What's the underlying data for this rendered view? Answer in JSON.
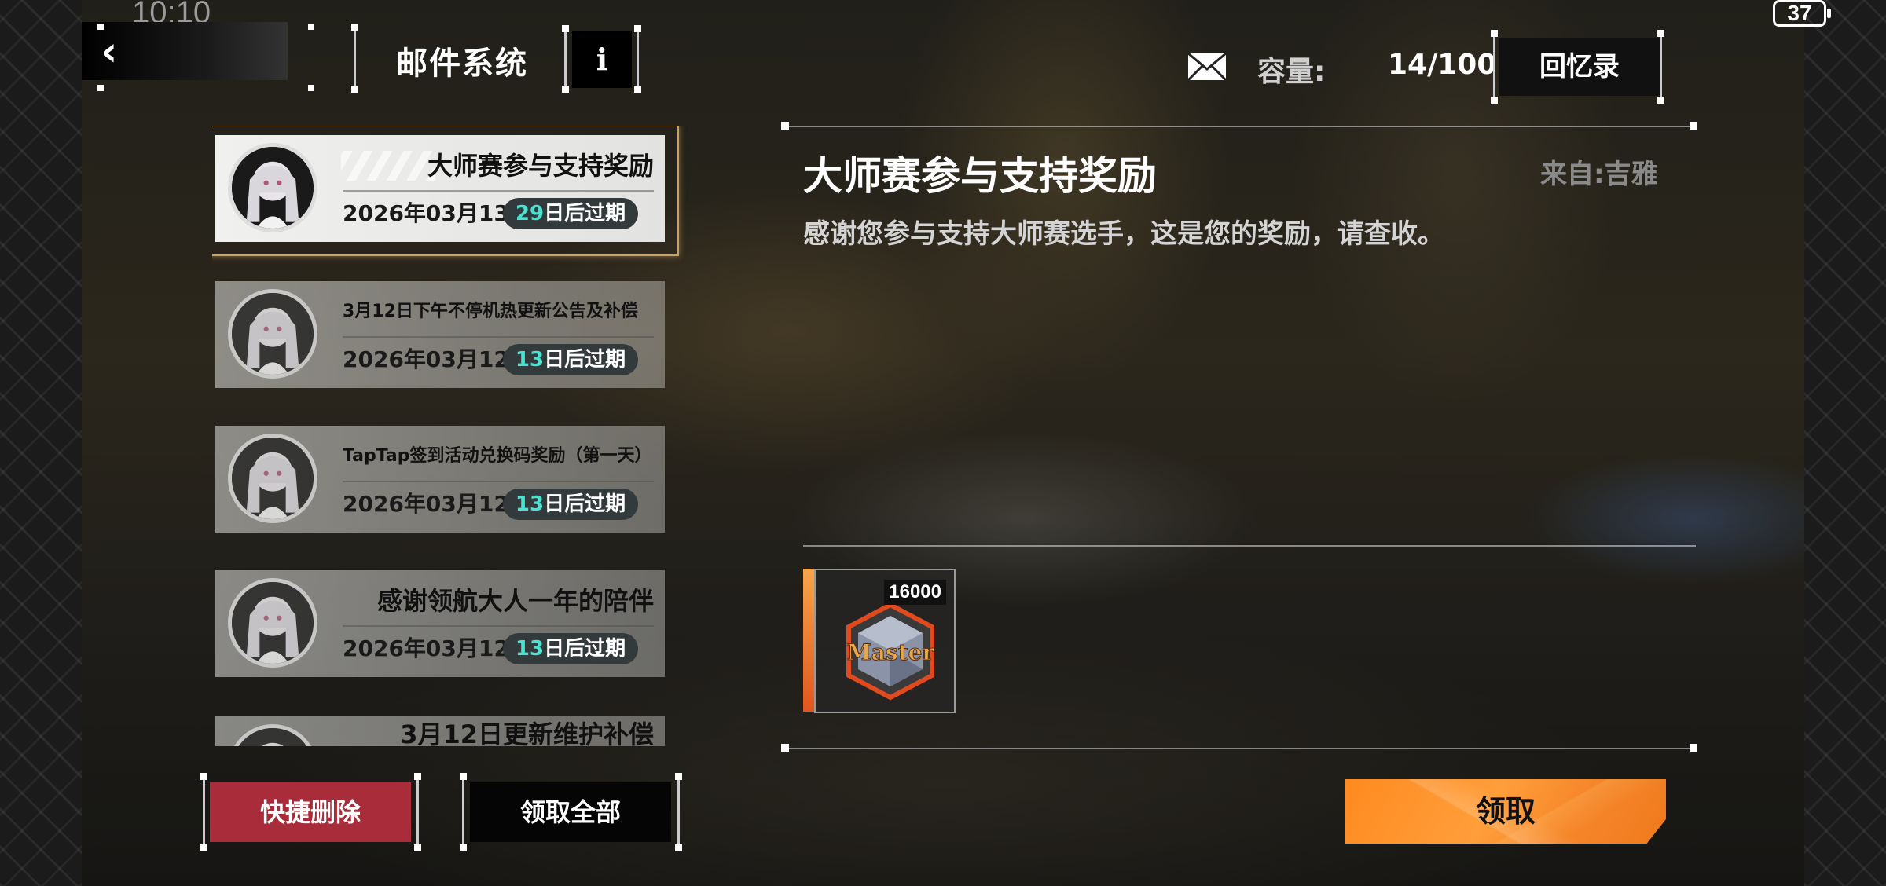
{
  "status_bar": {
    "time": "10:10",
    "battery": "37"
  },
  "header": {
    "title": "邮件系统",
    "info_label": "i",
    "capacity_label": "容量:",
    "capacity_value": "14/100",
    "memory_button": "回忆录"
  },
  "mails": [
    {
      "title": "大师赛参与支持奖励",
      "date": "2026年03月13日",
      "days": "29",
      "expiry_suffix": "日后过期",
      "selected": true
    },
    {
      "title": "3月12日下午不停机热更新公告及补偿",
      "date": "2026年03月12日",
      "days": "13",
      "expiry_suffix": "日后过期"
    },
    {
      "title": "TapTap签到活动兑换码奖励（第一天）",
      "date": "2026年03月12日",
      "days": "13",
      "expiry_suffix": "日后过期"
    },
    {
      "title": "感谢领航大人一年的陪伴",
      "date": "2026年03月12日",
      "days": "13",
      "expiry_suffix": "日后过期"
    },
    {
      "title": "3月12日更新维护补偿"
    }
  ],
  "list_actions": {
    "quick_delete": "快捷删除",
    "claim_all": "领取全部"
  },
  "detail": {
    "title": "大师赛参与支持奖励",
    "from": "来自:吉雅",
    "body": "感谢您参与支持大师赛选手，这是您的奖励，请查收。",
    "reward": {
      "quantity": "16000",
      "icon": "master-badge-icon",
      "emblem_text": "Master"
    },
    "claim_button": "领取"
  },
  "colors": {
    "accent_orange": "#ff8a20",
    "delete_red": "#a82c3a",
    "expiry_days": "#49e3d2",
    "selected_frame": "#c9a26a"
  }
}
